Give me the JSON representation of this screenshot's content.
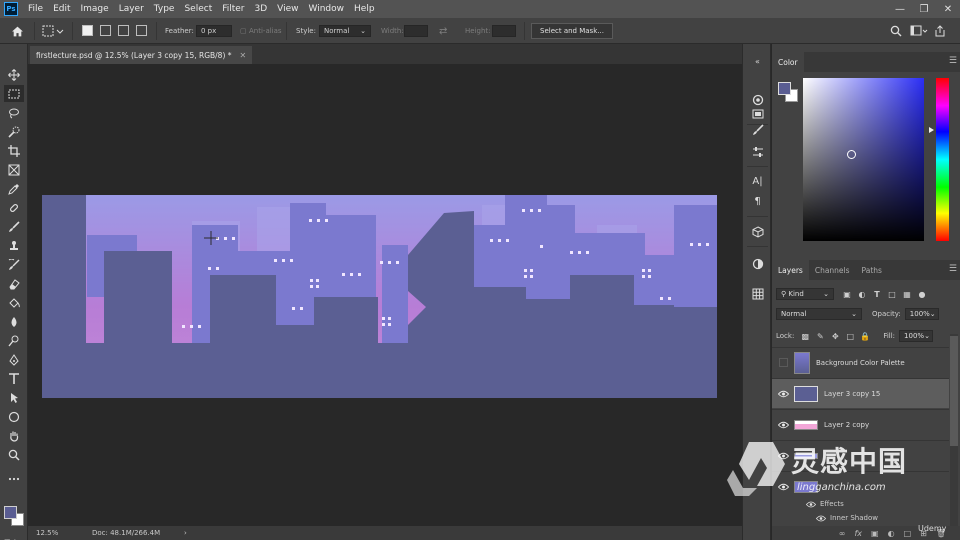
{
  "menu": {
    "logo": "Ps",
    "items": [
      "File",
      "Edit",
      "Image",
      "Layer",
      "Type",
      "Select",
      "Filter",
      "3D",
      "View",
      "Window",
      "Help"
    ]
  },
  "options": {
    "feather_label": "Feather:",
    "feather_value": "0 px",
    "antialias_label": "Anti-alias",
    "style_label": "Style:",
    "style_value": "Normal",
    "width_label": "Width:",
    "height_label": "Height:",
    "mask_button": "Select and Mask..."
  },
  "document": {
    "tab_title": "firstlecture.psd @ 12.5% (Layer 3 copy 15, RGB/8) *",
    "zoom": "12.5%",
    "doc_size": "Doc: 48.1M/266.4M"
  },
  "color_panel": {
    "title": "Color",
    "fg_color": "#5a5d92",
    "bg_color": "#ffffff"
  },
  "layers_panel": {
    "tabs": [
      "Layers",
      "Channels",
      "Paths"
    ],
    "filter_kind": "Kind",
    "blend_mode": "Normal",
    "opacity_label": "Opacity:",
    "opacity_value": "100%",
    "lock_label": "Lock:",
    "fill_label": "Fill:",
    "fill_value": "100%",
    "layers": [
      {
        "name": "Background Color Palette",
        "visible": false,
        "selected": false
      },
      {
        "name": "Layer 3 copy 15",
        "visible": true,
        "selected": true
      },
      {
        "name": "Layer 2 copy",
        "visible": true,
        "selected": false
      }
    ],
    "effects_label": "Effects",
    "inner_shadow_label": "Inner Shadow"
  },
  "watermark": {
    "title": "灵感中国",
    "url": "lingganchina.com",
    "brand": "Udemy"
  },
  "artwork_colors": {
    "sky_top": "#9b9ae6",
    "sky_bottom": "#b77dd6",
    "building_front": "#5b5f93",
    "building_mid": "#7b79cf",
    "window": "#f0e6ff"
  }
}
